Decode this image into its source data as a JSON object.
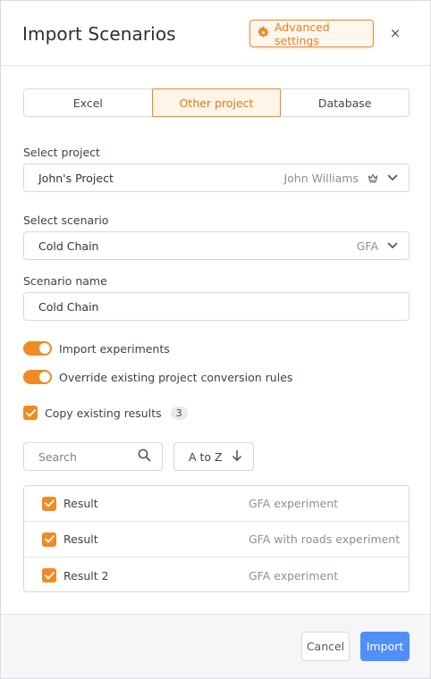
{
  "dialog": {
    "title": "Import Scenarios",
    "advanced_settings_label": "Advanced settings",
    "close_label": "×"
  },
  "source_tabs": [
    {
      "label": "Excel",
      "active": false
    },
    {
      "label": "Other project",
      "active": true
    },
    {
      "label": "Database",
      "active": false
    }
  ],
  "select_project": {
    "label": "Select project",
    "value": "John's Project",
    "owner": "John Williams",
    "icon": "crown-icon"
  },
  "select_scenario": {
    "label": "Select scenario",
    "value": "Cold Chain",
    "type": "GFA"
  },
  "scenario_name": {
    "label": "Scenario name",
    "value": "Cold Chain"
  },
  "toggles": [
    {
      "label": "Import experiments",
      "on": true
    },
    {
      "label": "Override existing project conversion rules",
      "on": true
    }
  ],
  "copy_results": {
    "label": "Copy existing results",
    "checked": true,
    "count": "3"
  },
  "search": {
    "placeholder": "Search"
  },
  "sort": {
    "label": "A to Z"
  },
  "results": [
    {
      "name": "Result",
      "experiment": "GFA experiment",
      "checked": true
    },
    {
      "name": "Result",
      "experiment": "GFA with roads experiment",
      "checked": true
    },
    {
      "name": "Result 2",
      "experiment": "GFA experiment",
      "checked": true
    }
  ],
  "footer": {
    "cancel_label": "Cancel",
    "import_label": "Import"
  },
  "colors": {
    "accent": "#f08a24",
    "primary": "#4f8ff7",
    "muted_text": "#8a9099"
  }
}
